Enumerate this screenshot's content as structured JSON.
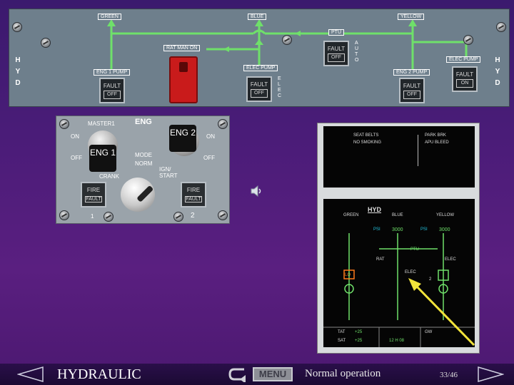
{
  "hyd_panel": {
    "systems": {
      "green": "GREEN",
      "blue": "BLUE",
      "yellow": "YELLOW"
    },
    "ptu_label": "PTU",
    "ptu_button": {
      "top": "FAULT",
      "bottom": "OFF"
    },
    "auto_label": "AUTO",
    "rat_man_on": "RAT MAN ON",
    "elec_pump_blue_label": "ELEC PUMP",
    "elec_pump_blue_button": {
      "top": "FAULT",
      "bottom": "OFF"
    },
    "elec_vert_label": "ELEC",
    "eng1_pump_label": "ENG 1 PUMP",
    "eng1_pump_button": {
      "top": "FAULT",
      "bottom": "OFF"
    },
    "eng2_pump_label": "ENG 2 PUMP",
    "eng2_pump_button": {
      "top": "FAULT",
      "bottom": "OFF"
    },
    "elec_pump_yellow_label": "ELEC PUMP",
    "elec_pump_yellow_button": {
      "top": "FAULT",
      "bottom": "ON"
    },
    "side_label": "HYD"
  },
  "eng_panel": {
    "title": "ENG",
    "master1_label": "MASTER1",
    "master1_box": "ENG 1",
    "master2_box": "ENG 2",
    "on_left": "ON",
    "off_left": "OFF",
    "on_right": "ON",
    "off_right": "OFF",
    "mode": "MODE",
    "norm": "NORM",
    "crank": "CRANK",
    "ign_start": "IGN/ START",
    "fire1": {
      "top": "FIRE",
      "bottom": "FAULT"
    },
    "fire2": {
      "top": "FIRE",
      "bottom": "FAULT"
    },
    "num1": "1",
    "num2": "2"
  },
  "ecam": {
    "upper_left_1": "SEAT BELTS",
    "upper_left_2": "NO SMOKING",
    "upper_right_1": "PARK BRK",
    "upper_right_2": "APU BLEED",
    "hyd_title": "HYD",
    "green": "GREEN",
    "blue": "BLUE",
    "yellow": "YELLOW",
    "psi_left": "PSI",
    "psi_right": "PSI",
    "blue_pressure": "3000",
    "yellow_pressure": "3000",
    "ptu": "PTU",
    "rat": "RAT",
    "elec_blue": "ELEC",
    "elec_yellow": "ELEC",
    "lo": "LO",
    "num2": "2",
    "tat": "TAT",
    "tat_val": "+25",
    "sat": "SAT",
    "sat_val": "+25",
    "time": "12 H 08",
    "gw": "GW"
  },
  "bottom_bar": {
    "title": "HYDRAULIC",
    "menu": "MENU",
    "subtitle": "Normal operation",
    "page": "33/46"
  },
  "colors": {
    "hyd_line": "#6fe06a",
    "panel": "#6e7f8c",
    "accent_yellow": "#f2e33a",
    "amber": "#ff7a1a",
    "ecam_cyan": "#22c4e0"
  }
}
